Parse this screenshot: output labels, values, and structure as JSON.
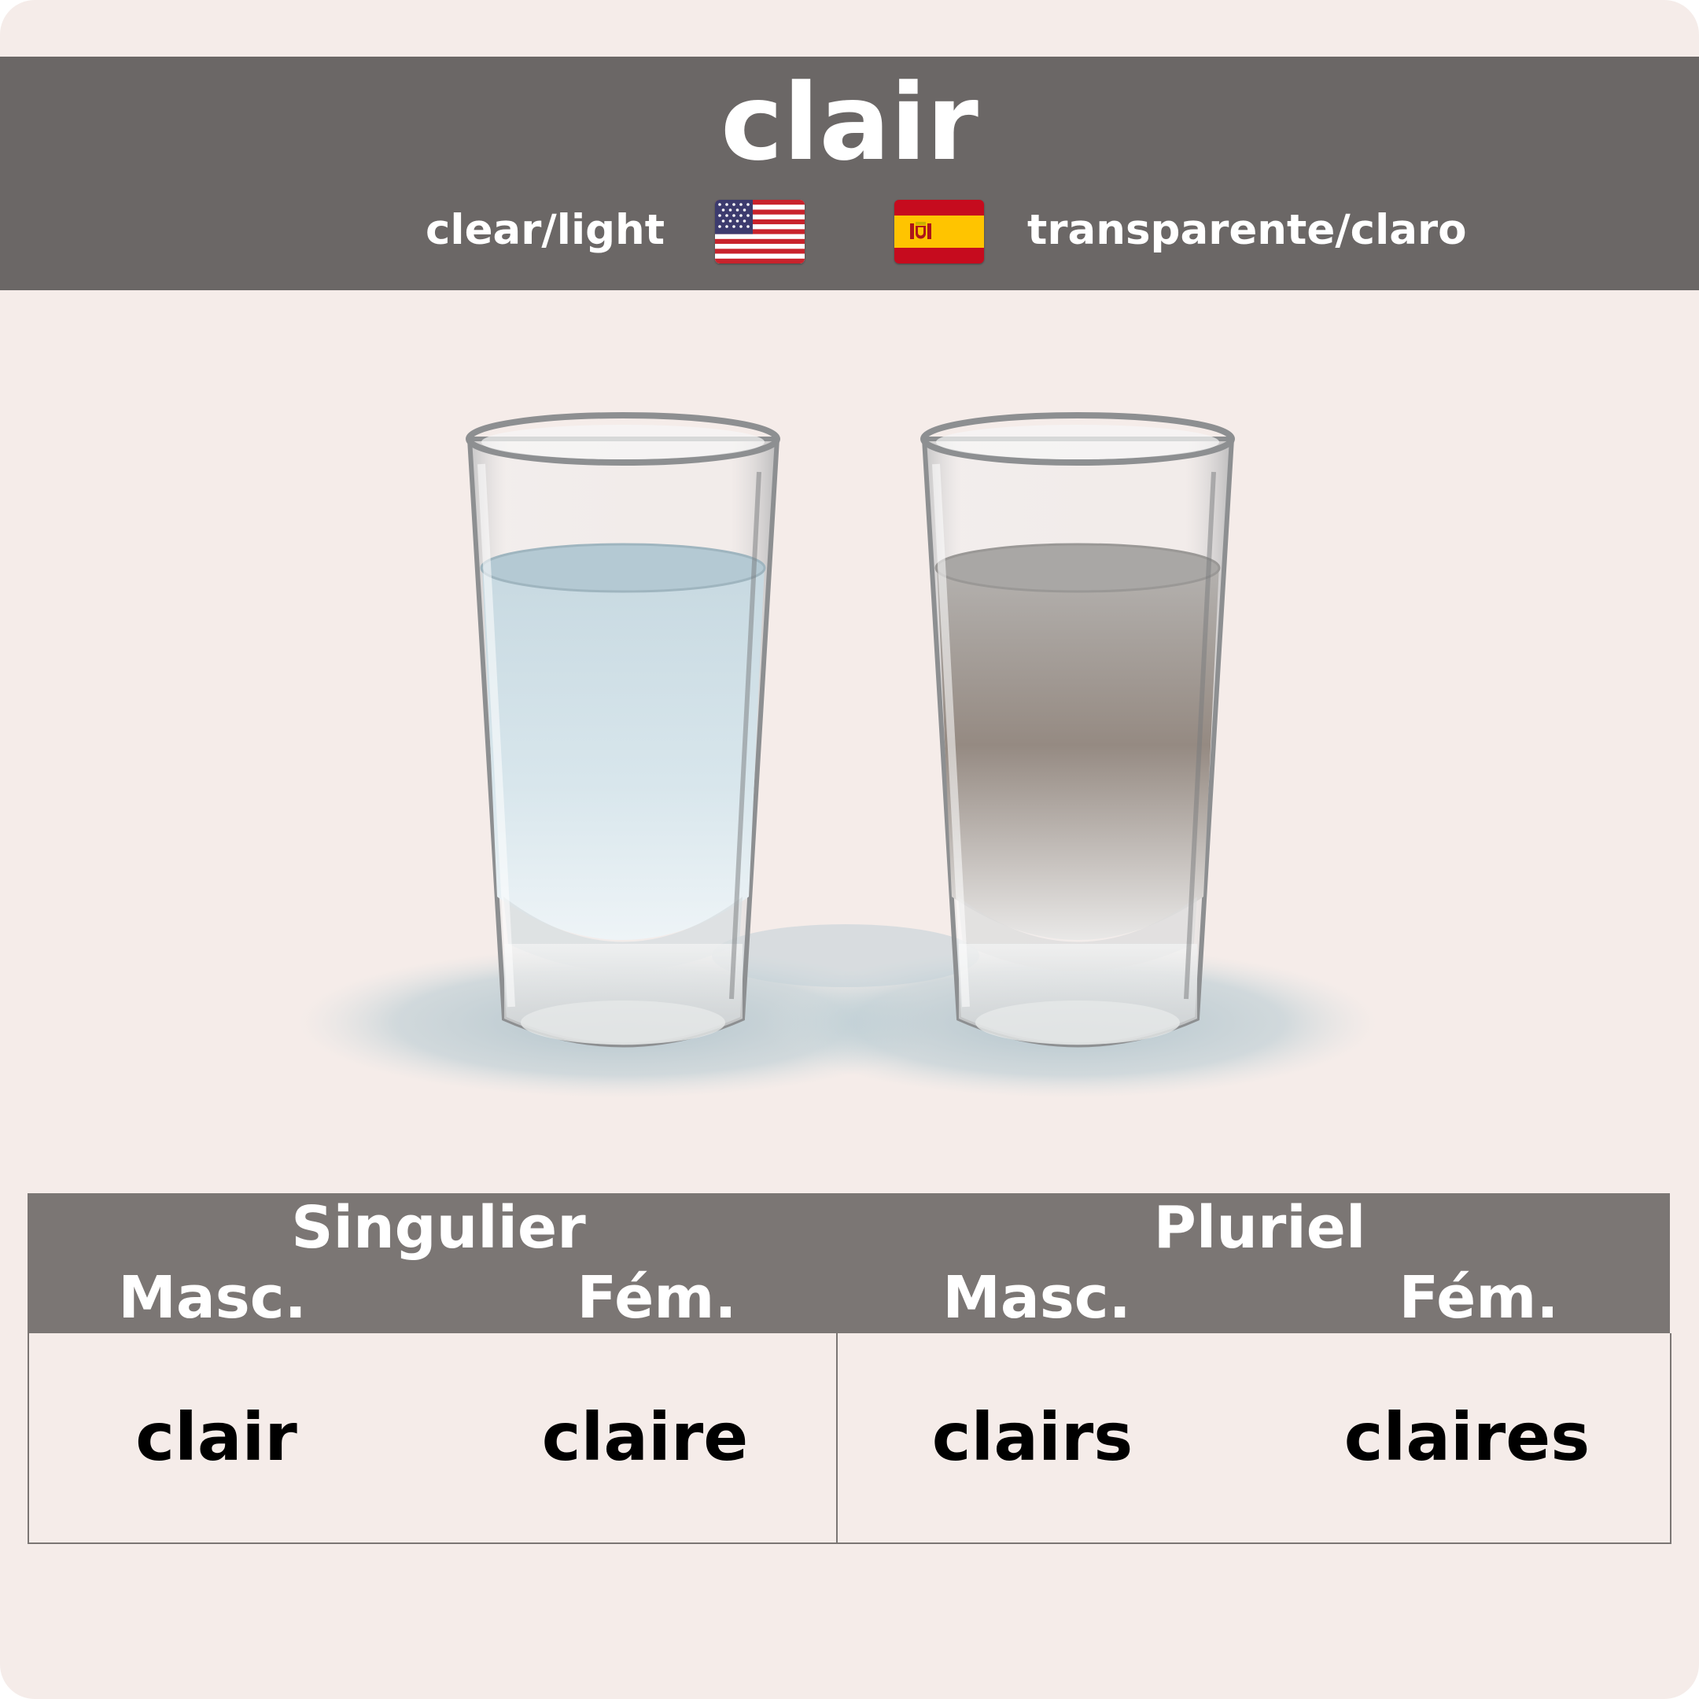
{
  "card": {
    "word": "clair",
    "translations": {
      "english": {
        "text": "clear/light",
        "flag_icon": "us-flag-icon"
      },
      "spanish": {
        "text": "transparente/claro",
        "flag_icon": "spain-flag-icon"
      }
    }
  },
  "illustration": {
    "items": [
      "clear-water-glass",
      "cloudy-water-glass"
    ]
  },
  "table": {
    "groups": [
      {
        "label": "Singulier",
        "masc_label": "Masc.",
        "fem_label": "Fém.",
        "masc": "clair",
        "fem": "claire"
      },
      {
        "label": "Pluriel",
        "masc_label": "Masc.",
        "fem_label": "Fém.",
        "masc": "clairs",
        "fem": "claires"
      }
    ]
  },
  "colors": {
    "background": "#f5ece9",
    "header": "#6b6766",
    "table_header": "#7b7674",
    "text_light": "#ffffff",
    "text_dark": "#000000"
  }
}
